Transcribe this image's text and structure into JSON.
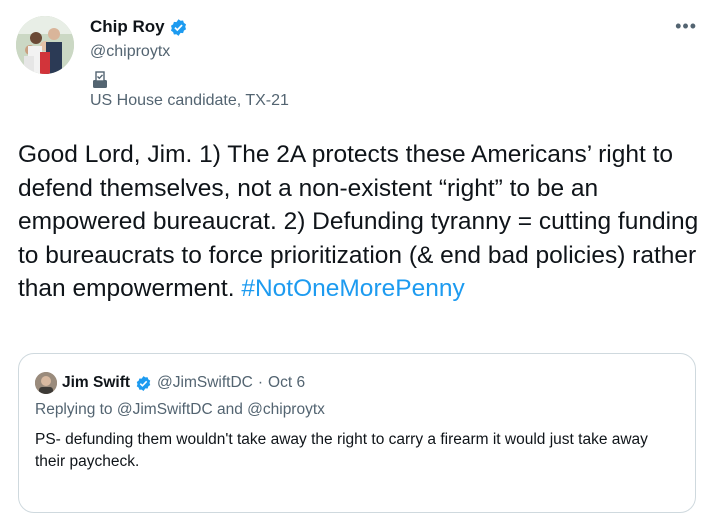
{
  "tweet": {
    "author_name": "Chip Roy",
    "author_handle": "@chiproytx",
    "author_label": "US House candidate, TX-21",
    "more_icon": "more-icon",
    "text": "Good Lord, Jim. 1) The 2A protects these Americans’ right to defend themselves, not a non-existent “right” to be an empowered bureaucrat. 2) Defunding tyranny = cutting funding to bureaucrats to force prioritization (& end bad policies) rather than empowerment.",
    "hashtag": "#NotOneMorePenny"
  },
  "quote": {
    "author_name": "Jim Swift",
    "author_handle": "@JimSwiftDC",
    "separator": "·",
    "date": "Oct 6",
    "replying_to": "Replying to @JimSwiftDC and @chiproytx",
    "text": "PS-  defunding them wouldn't take away the right to carry a firearm it would just take away their paycheck."
  },
  "colors": {
    "accent": "#1d9bf0",
    "secondary_text": "#536471",
    "border": "#cfd9de"
  }
}
